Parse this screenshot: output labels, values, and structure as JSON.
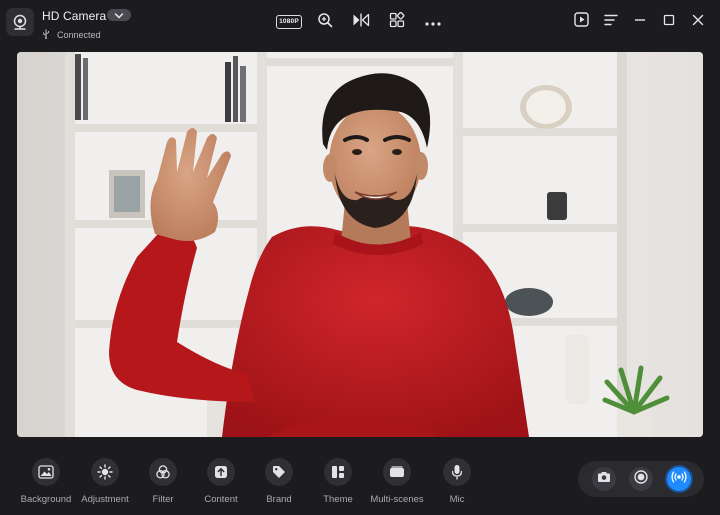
{
  "app": {
    "title": "HD Camera",
    "status": "Connected",
    "resolution": "1080P"
  },
  "toolbar": {
    "items": [
      {
        "label": "Background",
        "icon": "image-icon"
      },
      {
        "label": "Adjustment",
        "icon": "sun-icon"
      },
      {
        "label": "Filter",
        "icon": "filter-icon"
      },
      {
        "label": "Content",
        "icon": "upload-icon"
      },
      {
        "label": "Brand",
        "icon": "tag-icon"
      },
      {
        "label": "Theme",
        "icon": "grid-icon"
      },
      {
        "label": "Multi-scenes",
        "icon": "scenes-icon"
      },
      {
        "label": "Mic",
        "icon": "mic-icon"
      }
    ]
  },
  "colors": {
    "background": "#1c1c1f",
    "accent": "#1f8bff",
    "text": "#e9e9ec",
    "muted_text": "#a9a9b0"
  }
}
